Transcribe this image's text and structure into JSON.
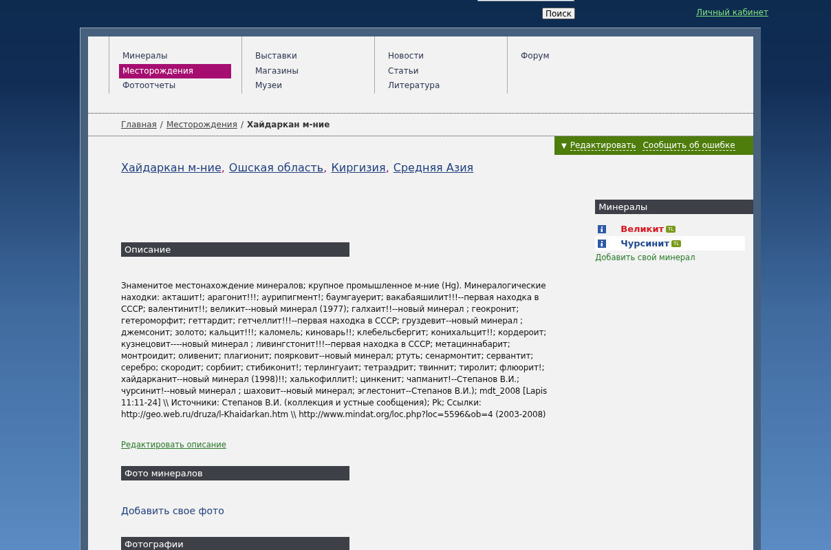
{
  "header": {
    "search_button": "Поиск",
    "account_link": "Личный кабинет"
  },
  "nav": {
    "columns": [
      [
        {
          "label": "Минералы",
          "selected": false
        },
        {
          "label": "Месторождения",
          "selected": true
        },
        {
          "label": "Фотоотчеты",
          "selected": false
        }
      ],
      [
        {
          "label": "Выставки",
          "selected": false
        },
        {
          "label": "Магазины",
          "selected": false
        },
        {
          "label": "Музеи",
          "selected": false
        }
      ],
      [
        {
          "label": "Новости",
          "selected": false
        },
        {
          "label": "Статьи",
          "selected": false
        },
        {
          "label": "Литература",
          "selected": false
        }
      ],
      [
        {
          "label": "Форум",
          "selected": false
        }
      ]
    ]
  },
  "breadcrumb": {
    "links": [
      "Главная",
      "Месторождения"
    ],
    "separator": "/",
    "current": "Хайдаркан м-ние"
  },
  "actions": {
    "collapse_icon": "▼",
    "links": [
      "Редактировать",
      "Сообщить об ошибке"
    ]
  },
  "location": {
    "links": [
      "Хайдаркан м-ние",
      "Ошская область",
      "Киргизия",
      "Средняя Азия"
    ],
    "separator": ","
  },
  "sections": [
    {
      "title": "Описание",
      "text": "Знаменитое местонахождение минералов; крупное промышленное м-ние (Hg). Минералогические находки: акташит!; арагонит!!!; аурипигмент!; баумгауерит; вакабаяшилит!!!--первая находка в СССР; валентинит!!; великит--новый минерал (1977); галхаит!!--новый минерал ; геокронит; гетероморфит; геттардит; гетчеллит!!!--первая находка в СССР; груздевит--новый минерал ; джемсонит; золото; кальцит!!!; каломель; киноварь!!; клебельсбергит; конихальцит!!; кордероит; кузнецовит----новый минерал ; ливингстонит!!!--первая находка в СССР; метациннабарит; монтроидит; оливенит; плагионит; поярковит--новый минерал; ртуть; сенармонтит; сервантит; серебро; скородит; сорбиит; стибиконит!; терлингуаит; тетраэдрит; твиннит; тиролит; флюорит!; хайдарканит--новый минерал (1998)!!; халькофиллит!; цинкенит; чапманит!--Степанов В.И.; чурсинит!--новый минерал ; шаховит--новый минерал; эглестонит--Степанов В.И.); mdt_2008 [Lapis 11:11-24] \\\\ Источники: Степанов В.И. (коллекция и устные сообщения); Pk; Ссылки: http://geo.web.ru/druza/l-Khaidarkan.htm \\\\ http://www.mindat.org/loc.php?loc=5596&ob=4 (2003-2008)",
      "edit_link": "Редактировать описание"
    },
    {
      "title": "Фото минералов",
      "add_link": "Добавить свое фото"
    },
    {
      "title": "Фотографии"
    }
  ],
  "sidebar": {
    "title": "Минералы",
    "items": [
      {
        "name": "Великит",
        "badge": "TL",
        "color": "#d8141c",
        "highlighted": false
      },
      {
        "name": "Чурсинит",
        "badge": "TL",
        "color": "#1f4a8f",
        "highlighted": true
      }
    ],
    "add_link": "Добавить свой минерал"
  }
}
